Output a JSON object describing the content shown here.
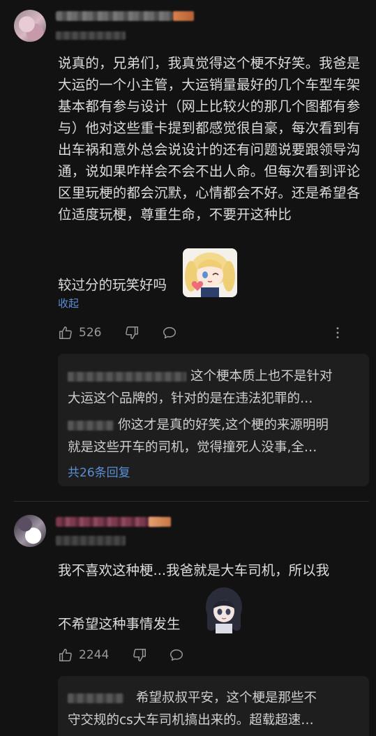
{
  "comments": [
    {
      "text": "说真的，兄弟们，我真觉得这个梗不好笑。我爸是大运的一个小主管，大运销量最好的几个车型车架基本都有参与设计（网上比较火的那几个图都有参与）他对这些重卡提到都感觉很自豪，每次看到有出车祸和意外总会说设计的还有问题说要跟领导沟通，说如果咋样会不会不出人命。但每次看到评论区里玩梗的都会沉默，心情都会不好。还是希望各位适度玩梗，尊重生命，不要开这种比",
      "text_end_before": "较过分的玩笑好吗",
      "text_end_after": "。",
      "sticker_icon": "blonde-anime-girl-heart-sticker",
      "collapse_label": "收起",
      "likes": "526",
      "replies": [
        {
          "text": "这个梗本质上也不是针对"
        },
        {
          "text": "大运这个品牌的，针对的是在违法犯罪的…"
        },
        {
          "text": "你这才是真的好笑,这个梗的来源明明"
        },
        {
          "text": "就是这些开车的司机，觉得撞死人没事,全…"
        }
      ],
      "reply_count_label": "共26条回复"
    },
    {
      "line1": "我不喜欢这种梗...我爸就是大车司机，所以我",
      "line2": "不希望这种事情发生",
      "sticker_icon": "dark-hair-anime-girl-sticker",
      "likes": "2244",
      "replies": [
        {
          "text": "希望叔叔平安，这个梗是那些不"
        },
        {
          "text": "守交规的cs大车司机搞出来的。超载超速…"
        }
      ]
    }
  ],
  "icons": {
    "like": "thumbs-up-icon",
    "dislike": "thumbs-down-icon",
    "reply": "comment-bubble-icon",
    "more": "more-vertical-icon"
  },
  "colors": {
    "background": "#121212",
    "reply_background": "#1e1e1e",
    "link": "#5b8fd6",
    "text": "#dcdcdc",
    "icon": "#9a9a9a"
  }
}
